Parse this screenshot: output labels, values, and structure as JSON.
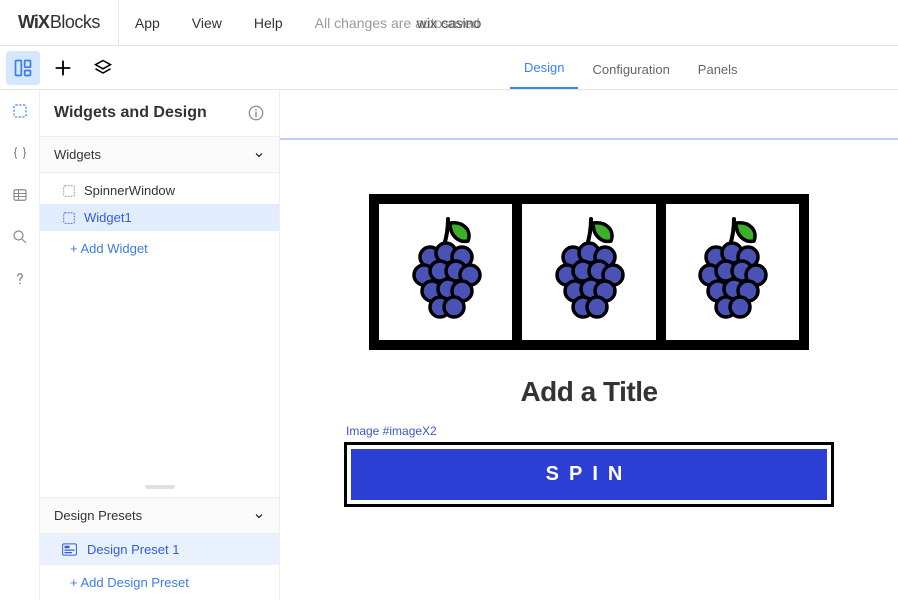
{
  "brand": {
    "wix": "WiX",
    "blocks": "Blocks"
  },
  "top_menu": {
    "app": "App",
    "view": "View",
    "help": "Help"
  },
  "autosave_text": "All changes are autosaved",
  "app_name": "wix casino",
  "tabs": {
    "design": "Design",
    "configuration": "Configuration",
    "panels": "Panels"
  },
  "side": {
    "header": "Widgets and Design",
    "widgets_label": "Widgets",
    "widgets": {
      "item0": "SpinnerWindow",
      "item1": "Widget1"
    },
    "add_widget": "+ Add Widget",
    "presets_label": "Design Presets",
    "presets": {
      "item0": "Design Preset 1"
    },
    "add_preset": "+ Add Design Preset"
  },
  "canvas": {
    "title_placeholder": "Add a Title",
    "selection_label": "Image #imageX2",
    "spin_label": "SPIN"
  }
}
